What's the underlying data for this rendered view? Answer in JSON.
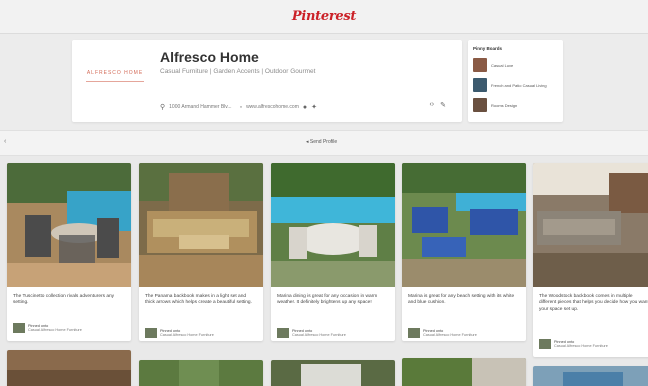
{
  "header": {
    "logo": "Pinterest"
  },
  "profile": {
    "brand_mark": "ALFRESCO HOME",
    "name": "Alfresco Home",
    "tagline": "Casual Furniture | Garden Accents | Outdoor Gourmet",
    "location": "1000 Armand Hammer Blv...",
    "website": "www.alfrescohome.com"
  },
  "boards": {
    "title": "Pinny Boards",
    "items": [
      {
        "label": "Casual Luxe",
        "color": "#8a5a45"
      },
      {
        "label": "French and Patio Casual Living",
        "color": "#3c5a6e"
      },
      {
        "label": "Rooms Design",
        "color": "#6a5040"
      }
    ]
  },
  "subbar": {
    "button": "Send Profile"
  },
  "pins": [
    {
      "desc": "The Tuscinetto collection rivals adventurers any setting.",
      "pinned_by": "Pinned onto",
      "board": "Casual Alfresco Home Furniture"
    },
    {
      "desc": "The Panama backbook makes in a light set and thick arrows which helps create a beautiful setting.",
      "pinned_by": "Pinned onto",
      "board": "Casual Alfresco Home Furniture"
    },
    {
      "desc": "Marina dining is great for any occasion in warm weather. It definitely brightens up any space!",
      "pinned_by": "Pinned onto",
      "board": "Casual Alfresco Home Furniture"
    },
    {
      "desc": "Marina is great for any beach setting with its white and blue cushion.",
      "pinned_by": "Pinned onto",
      "board": "Casual Alfresco Home Furniture"
    },
    {
      "desc": "The Woodstock backbook comes in multiple different pieces that helps you decide how you want your space set up.",
      "pinned_by": "Pinned onto",
      "board": "Casual Alfresco Home Furniture"
    }
  ]
}
